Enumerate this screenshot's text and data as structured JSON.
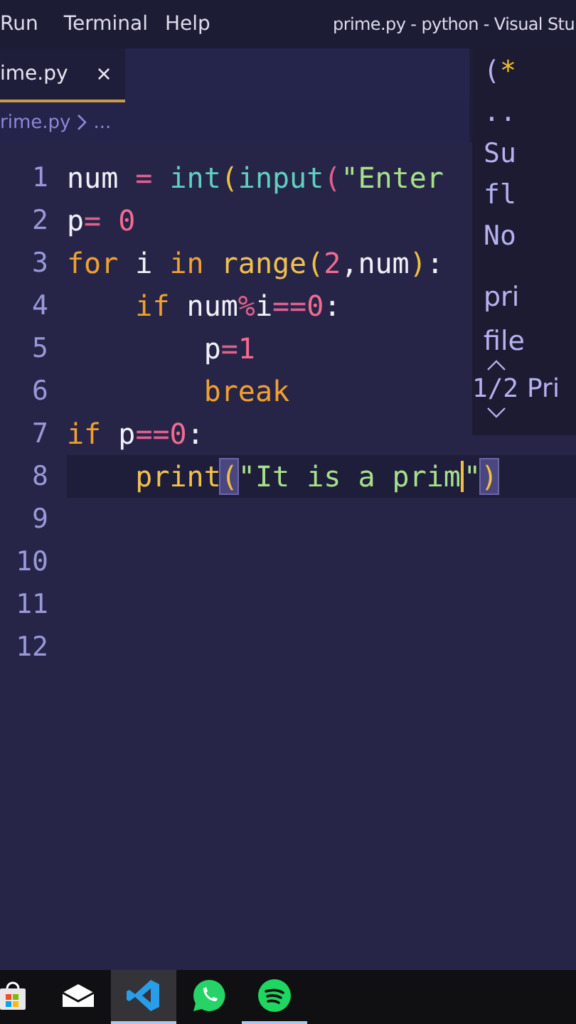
{
  "menu_bar": {
    "items": [
      "Run",
      "Terminal",
      "Help"
    ],
    "title": "prime.py - python - Visual Stu"
  },
  "tabs": [
    {
      "label": "ime.py",
      "close": "×",
      "selected": true
    }
  ],
  "breadcrumb": {
    "items": [
      "rime.py",
      "..."
    ]
  },
  "editor": {
    "lines": [
      {
        "number": "1",
        "current": false,
        "tokens": [
          {
            "text": "num",
            "kind": "var"
          },
          {
            "text": " = ",
            "kind": "op"
          },
          {
            "text": "int",
            "kind": "func"
          },
          {
            "text": "(",
            "kind": "paren"
          },
          {
            "text": "input",
            "kind": "func"
          },
          {
            "text": "(",
            "kind": "paren2"
          },
          {
            "text": "\"Enter",
            "kind": "string"
          }
        ]
      },
      {
        "number": "2",
        "current": false,
        "tokens": [
          {
            "text": "p",
            "kind": "var"
          },
          {
            "text": "= ",
            "kind": "op"
          },
          {
            "text": "0",
            "kind": "number"
          }
        ]
      },
      {
        "number": "3",
        "current": false,
        "tokens": [
          {
            "text": "for",
            "kind": "keyword"
          },
          {
            "text": " i ",
            "kind": "var"
          },
          {
            "text": "in",
            "kind": "keyword"
          },
          {
            "text": " range",
            "kind": "builtin"
          },
          {
            "text": "(",
            "kind": "paren"
          },
          {
            "text": "2",
            "kind": "number"
          },
          {
            "text": ",num",
            "kind": "var"
          },
          {
            "text": ")",
            "kind": "paren"
          },
          {
            "text": ":",
            "kind": "var"
          }
        ]
      },
      {
        "number": "4",
        "current": false,
        "tokens": [
          {
            "text": "    if",
            "kind": "keyword"
          },
          {
            "text": " num",
            "kind": "var"
          },
          {
            "text": "%",
            "kind": "op"
          },
          {
            "text": "i",
            "kind": "var"
          },
          {
            "text": "==",
            "kind": "op"
          },
          {
            "text": "0",
            "kind": "number"
          },
          {
            "text": ":",
            "kind": "var"
          }
        ]
      },
      {
        "number": "5",
        "current": false,
        "tokens": [
          {
            "text": "        p",
            "kind": "var"
          },
          {
            "text": "=",
            "kind": "op"
          },
          {
            "text": "1",
            "kind": "number"
          }
        ]
      },
      {
        "number": "6",
        "current": false,
        "tokens": [
          {
            "text": "        break",
            "kind": "keyword"
          }
        ]
      },
      {
        "number": "7",
        "current": false,
        "tokens": [
          {
            "text": "if",
            "kind": "keyword"
          },
          {
            "text": " p",
            "kind": "var"
          },
          {
            "text": "==",
            "kind": "op"
          },
          {
            "text": "0",
            "kind": "number"
          },
          {
            "text": ":",
            "kind": "var"
          }
        ]
      },
      {
        "number": "8",
        "current": true,
        "tokens": [
          {
            "text": "    print",
            "kind": "builtin"
          },
          {
            "text": "(",
            "kind": "paren-match"
          },
          {
            "text": "\"It is a prim",
            "kind": "string"
          },
          {
            "kind": "cursor"
          },
          {
            "text": "\"",
            "kind": "string"
          },
          {
            "text": ")",
            "kind": "paren-match"
          }
        ]
      },
      {
        "number": "9",
        "current": false
      },
      {
        "number": "10",
        "current": false
      },
      {
        "number": "11",
        "current": false
      },
      {
        "number": "12",
        "current": false
      }
    ]
  },
  "peek": {
    "lines": [
      {
        "text": "(",
        "accent": "*",
        "kind": "code"
      },
      {
        "text": "..",
        "kind": "code"
      },
      {
        "text": "Su",
        "kind": "code"
      },
      {
        "text": "fl",
        "kind": "code"
      },
      {
        "text": "No",
        "kind": "code"
      },
      {
        "text": "pri",
        "kind": "prose"
      },
      {
        "text": "file",
        "kind": "prose"
      }
    ],
    "counter": "1/2",
    "signature": "Pri"
  },
  "taskbar": {
    "items": [
      {
        "kind": "store",
        "selected": false,
        "running": false
      },
      {
        "kind": "mail",
        "selected": false,
        "running": false
      },
      {
        "kind": "code",
        "selected": true,
        "running": true
      },
      {
        "kind": "chat",
        "selected": false,
        "running": false
      },
      {
        "kind": "music",
        "selected": false,
        "running": true
      }
    ]
  }
}
